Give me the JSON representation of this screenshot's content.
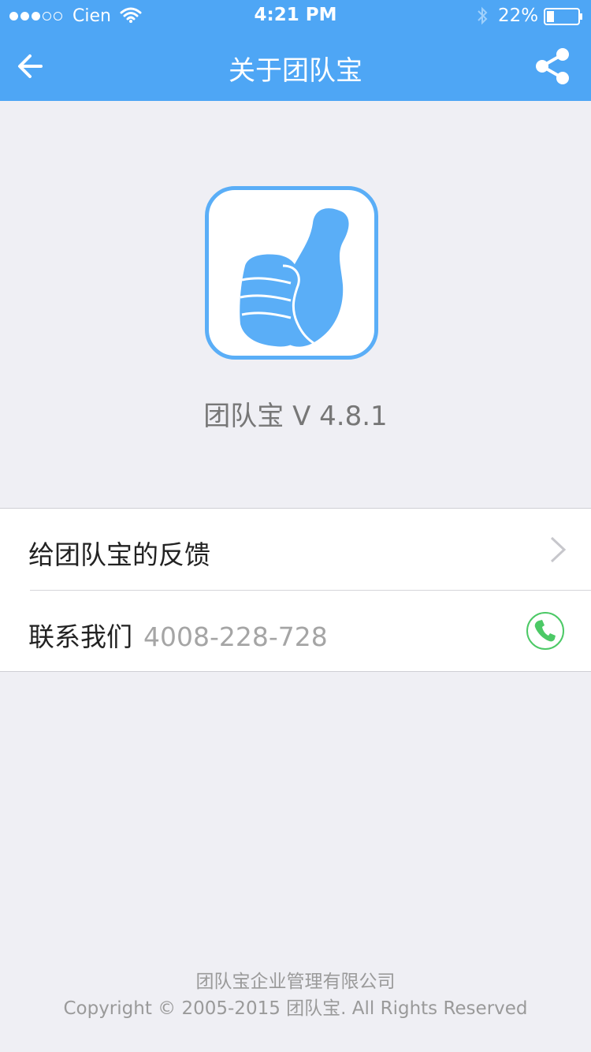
{
  "status_bar": {
    "carrier": "Cien",
    "time": "4:21 PM",
    "battery": "22%",
    "signal_bars_filled": 3,
    "signal_bars_total": 5
  },
  "nav": {
    "title": "关于团队宝",
    "back_icon": "back-arrow-icon",
    "share_icon": "share-icon"
  },
  "app": {
    "logo_icon": "thumbs-up-icon",
    "version_text": "团队宝 V 4.8.1"
  },
  "list": {
    "feedback_label": "给团队宝的反馈",
    "contact_label": "联系我们",
    "contact_phone": "4008-228-728"
  },
  "footer": {
    "company": "团队宝企业管理有限公司",
    "copyright": "Copyright © 2005-2015 团队宝. All Rights Reserved"
  },
  "colors": {
    "header": "#4ea6f5",
    "logo": "#5aaef7",
    "call_green": "#4cc966",
    "background": "#efeff4"
  }
}
